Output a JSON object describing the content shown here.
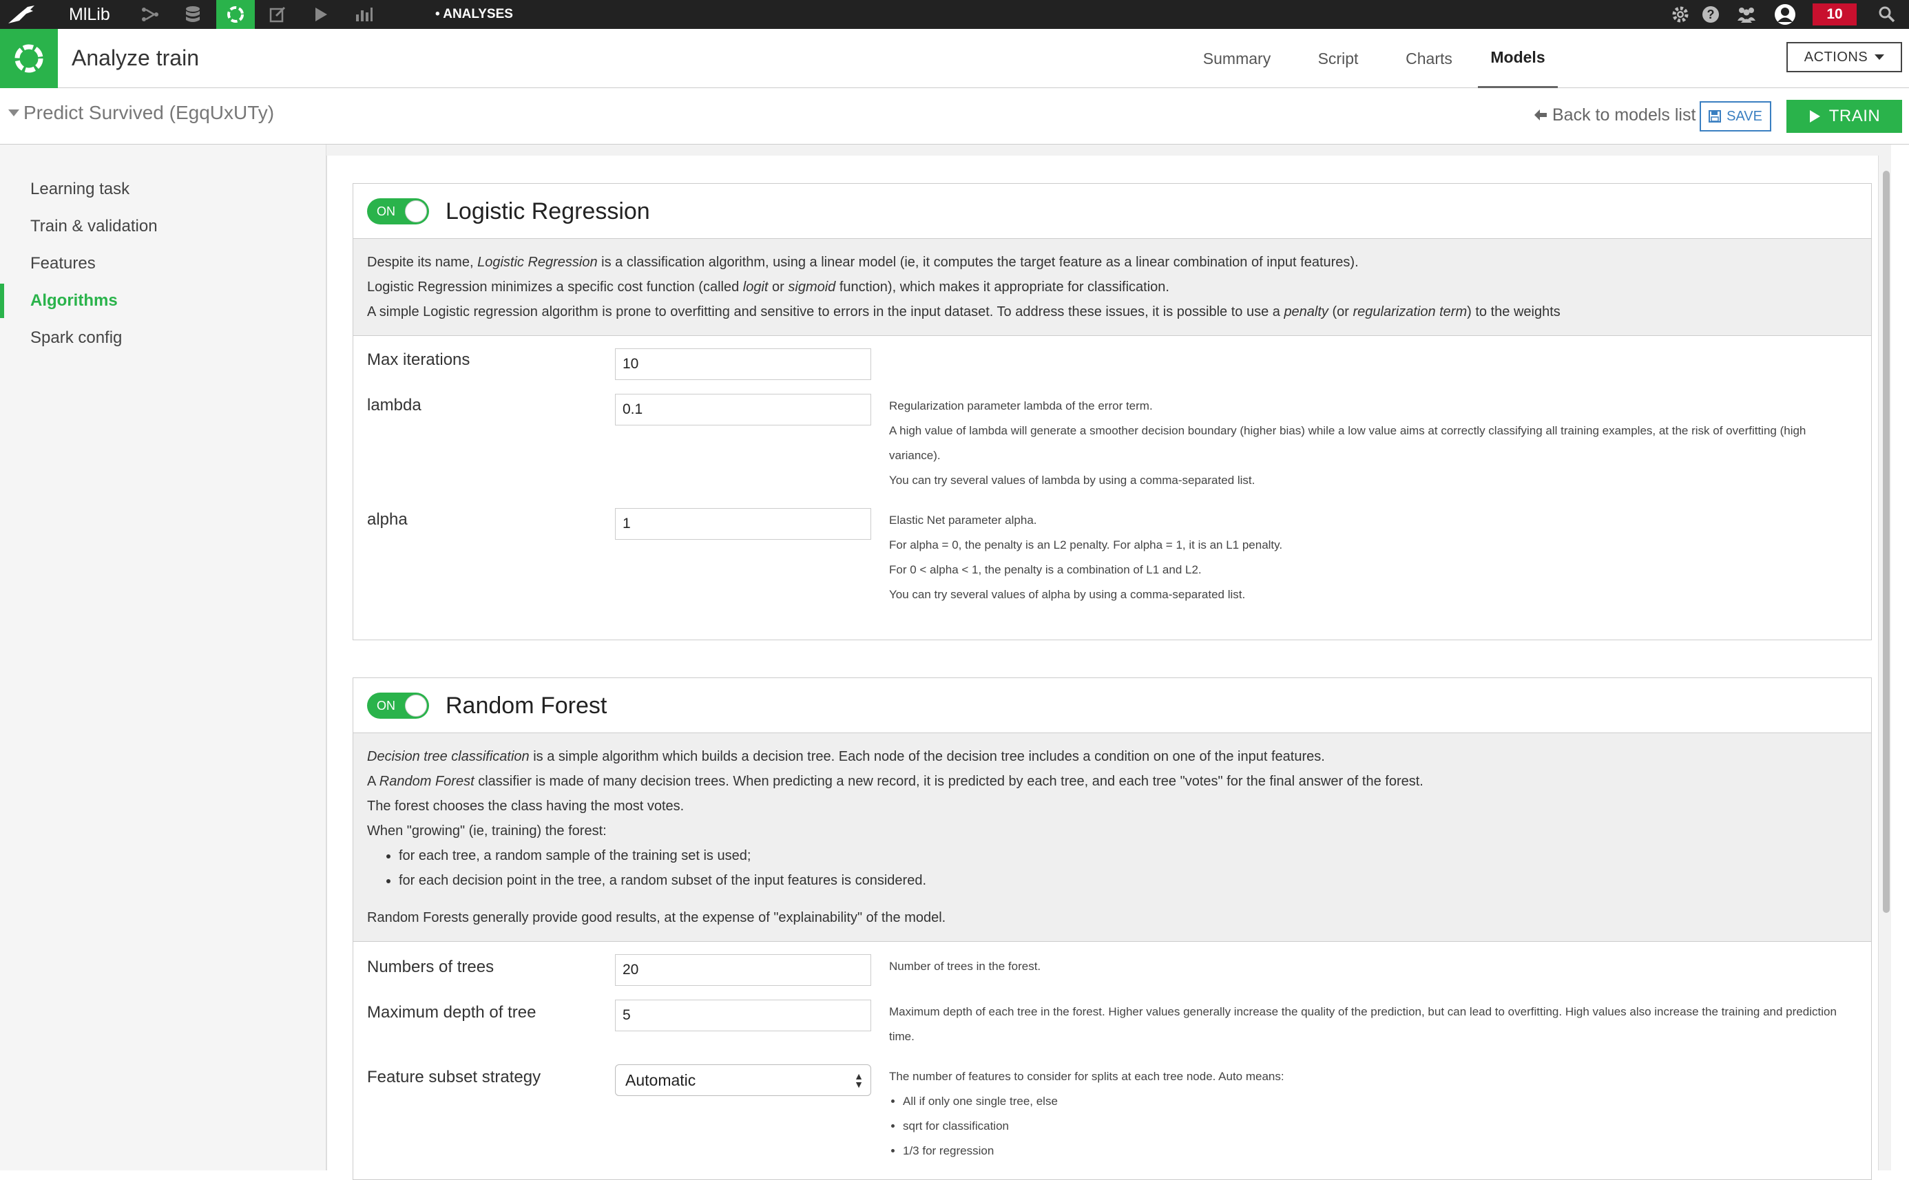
{
  "topbar": {
    "project": "MlLib",
    "crumb": "• ANALYSES",
    "notifications": "10"
  },
  "header": {
    "title": "Analyze train",
    "tabs": [
      "Summary",
      "Script",
      "Charts",
      "Models"
    ],
    "active_tab": "Models",
    "actions": "ACTIONS"
  },
  "subbar": {
    "model_title": "Predict Survived (EgqUxUTy)",
    "back": "Back to models list",
    "save": "SAVE",
    "train": "TRAIN"
  },
  "sidebar": {
    "items": [
      "Learning task",
      "Train & validation",
      "Features",
      "Algorithms",
      "Spark config"
    ],
    "active": "Algorithms"
  },
  "lr": {
    "toggle": "ON",
    "title": "Logistic Regression",
    "desc": [
      [
        {
          "t": "Despite its name, "
        },
        {
          "t": "Logistic Regression",
          "i": true
        },
        {
          "t": " is a classification algorithm, using a linear model (ie, it computes the target feature as a linear combination of input features)."
        }
      ],
      [
        {
          "t": "Logistic Regression minimizes a specific cost function (called "
        },
        {
          "t": "logit",
          "i": true
        },
        {
          "t": " or "
        },
        {
          "t": "sigmoid",
          "i": true
        },
        {
          "t": " function), which makes it appropriate for classification."
        }
      ],
      [
        {
          "t": "A simple Logistic regression algorithm is prone to overfitting and sensitive to errors in the input dataset. To address these issues, it is possible to use a "
        },
        {
          "t": "penalty",
          "i": true
        },
        {
          "t": " (or "
        },
        {
          "t": "regularization term",
          "i": true
        },
        {
          "t": ") to the weights"
        }
      ]
    ],
    "params": {
      "max_iter_label": "Max iterations",
      "max_iter": "10",
      "lambda_label": "lambda",
      "lambda": "0.1",
      "alpha_label": "alpha",
      "alpha": "1"
    },
    "lambda_help": [
      "Regularization parameter lambda of the error term.",
      "A high value of lambda will generate a smoother decision boundary (higher bias) while a low value aims at correctly classifying all training examples, at the risk of overfitting (high variance).",
      "You can try several values of lambda by using a comma-separated list."
    ],
    "alpha_help": [
      "Elastic Net parameter alpha.",
      "For alpha = 0, the penalty is an L2 penalty. For alpha = 1, it is an L1 penalty.",
      "For 0 < alpha < 1, the penalty is a combination of L1 and L2.",
      "You can try several values of alpha by using a comma-separated list."
    ]
  },
  "rf": {
    "toggle": "ON",
    "title": "Random Forest",
    "desc": [
      [
        {
          "t": "Decision tree classification",
          "i": true
        },
        {
          "t": " is a simple algorithm which builds a decision tree. Each node of the decision tree includes a condition on one of the input features."
        }
      ],
      [
        {
          "t": "A "
        },
        {
          "t": "Random Forest",
          "i": true
        },
        {
          "t": " classifier is made of many decision trees. When predicting a new record, it is predicted by each tree, and each tree \"votes\" for the final answer of the forest."
        }
      ],
      [
        {
          "t": "The forest chooses the class having the most votes."
        }
      ],
      [
        {
          "t": "When \"growing\" (ie, training) the forest:"
        }
      ]
    ],
    "bullets": [
      "for each tree, a random sample of the training set is used;",
      "for each decision point in the tree, a random subset of the input features is considered."
    ],
    "desc_end": "Random Forests generally provide good results, at the expense of \"explainability\" of the model.",
    "params": {
      "trees_label": "Numbers of trees",
      "trees": "20",
      "depth_label": "Maximum depth of tree",
      "depth": "5",
      "subset_label": "Feature subset strategy",
      "subset": "Automatic"
    },
    "trees_help": "Number of trees in the forest.",
    "depth_help": "Maximum depth of each tree in the forest. Higher values generally increase the quality of the prediction, but can lead to overfitting. High values also increase the training and prediction time.",
    "subset_help": "The number of features to consider for splits at each tree node. Auto means:",
    "subset_bullets": [
      "All if only one single tree, else",
      "sqrt for classification",
      "1/3 for regression"
    ]
  }
}
